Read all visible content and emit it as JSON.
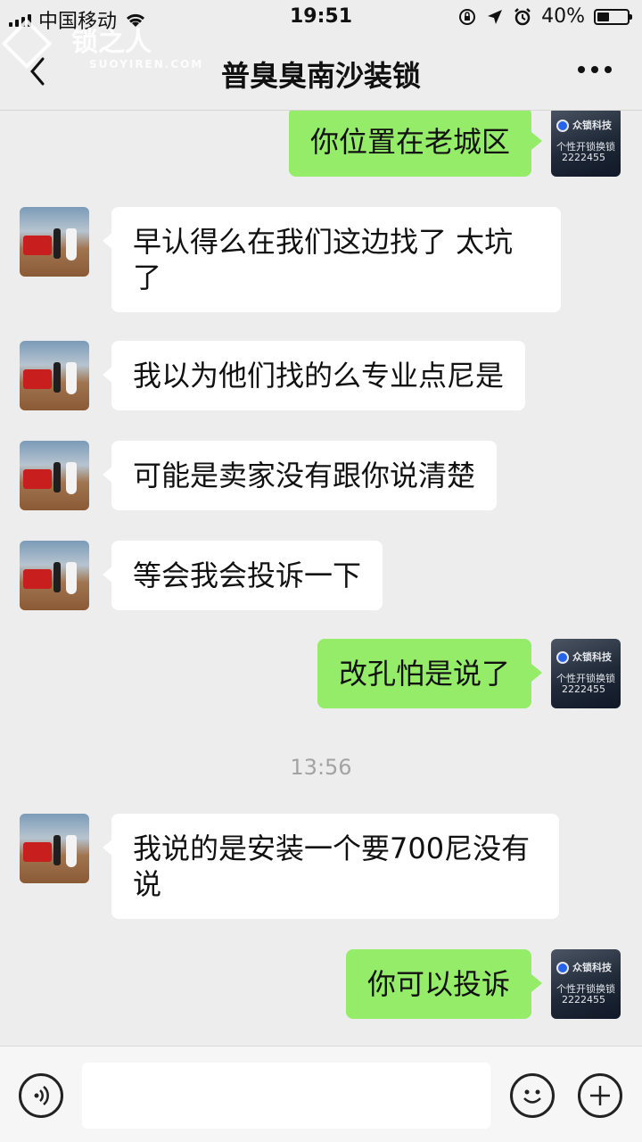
{
  "status_bar": {
    "carrier": "中国移动",
    "time": "19:51",
    "battery": "40%",
    "battery_level": 0.4
  },
  "watermark": {
    "text": "锁之人",
    "sub": "SUOYIREN.COM"
  },
  "header": {
    "title": "普臭臭南沙装锁"
  },
  "messages": [
    {
      "side": "out",
      "text": "你位置在老城区"
    },
    {
      "side": "in",
      "text": "早认得么在我们这边找了   太坑了"
    },
    {
      "side": "in",
      "text": "我以为他们找的么专业点尼是"
    },
    {
      "side": "in",
      "text": "可能是卖家没有跟你说清楚"
    },
    {
      "side": "in",
      "text": "等会我会投诉一下"
    },
    {
      "side": "out",
      "text": "改孔怕是说了"
    },
    {
      "timestamp": "13:56"
    },
    {
      "side": "in",
      "text": "我说的是安装一个要700尼没有说"
    },
    {
      "side": "out",
      "text": "你可以投诉"
    }
  ],
  "self_avatar": {
    "line1": "众锁科技",
    "line2": "个性开锁换锁",
    "line3": "2222455"
  },
  "input_bar": {
    "value": ""
  }
}
